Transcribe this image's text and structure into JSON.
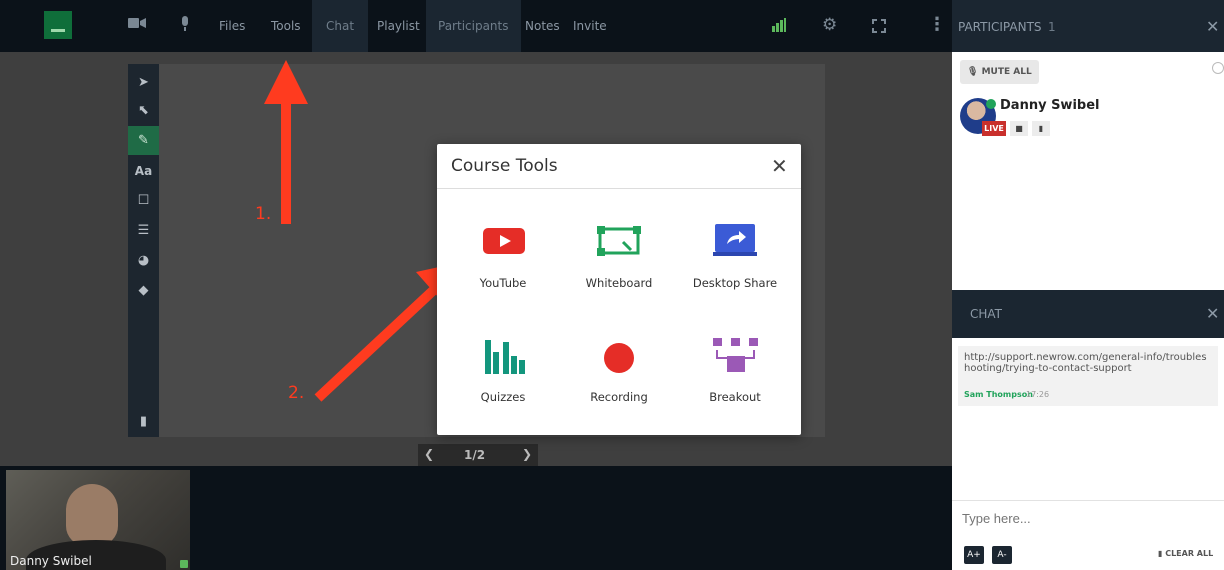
{
  "topbar": {
    "items": [
      {
        "label": "Files"
      },
      {
        "label": "Tools"
      },
      {
        "label": "Chat"
      },
      {
        "label": "Playlist"
      },
      {
        "label": "Participants"
      },
      {
        "label": "Notes"
      },
      {
        "label": "Invite"
      }
    ],
    "icons": {
      "camera": "video-camera-icon",
      "mic": "microphone-icon",
      "signal": "signal-strength-icon",
      "settings": "gear-icon",
      "fullscreen": "fullscreen-icon",
      "more": "more-vertical-icon"
    },
    "signal_color": "#5cb85c"
  },
  "whiteboard": {
    "page": "1/2",
    "tools": [
      "select-icon",
      "pointer-icon",
      "pen-icon",
      "text-icon",
      "rectangle-icon",
      "line-width-icon",
      "palette-icon",
      "eraser-icon"
    ],
    "text_tool_label": "Aa"
  },
  "modal": {
    "title": "Course Tools",
    "tiles": [
      {
        "label": "YouTube",
        "icon": "youtube-icon",
        "color": "#e52d27"
      },
      {
        "label": "Whiteboard",
        "icon": "whiteboard-icon",
        "color": "#21a35b"
      },
      {
        "label": "Desktop Share",
        "icon": "desktop-share-icon",
        "color": "#3b5bd6"
      },
      {
        "label": "Quizzes",
        "icon": "quizzes-icon",
        "color": "#13967d"
      },
      {
        "label": "Recording",
        "icon": "recording-icon",
        "color": "#e52d27"
      },
      {
        "label": "Breakout",
        "icon": "breakout-icon",
        "color": "#9b59b6"
      }
    ]
  },
  "annotations": {
    "step1": "1.",
    "step2": "2."
  },
  "video": {
    "name": "Danny Swibel"
  },
  "participants_panel": {
    "title": "PARTICIPANTS",
    "count": "1",
    "mute_all": "MUTE ALL",
    "participant": {
      "name": "Danny Swibel",
      "live": "LIVE"
    }
  },
  "chat_panel": {
    "title": "CHAT",
    "message": {
      "text": "http://support.newrow.com/general-info/troubleshooting/trying-to-contact-support",
      "author": "Sam Thompson",
      "time": "17:26"
    },
    "input_placeholder": "Type here...",
    "font_up": "A+",
    "font_down": "A-",
    "clear_all": "CLEAR ALL"
  }
}
